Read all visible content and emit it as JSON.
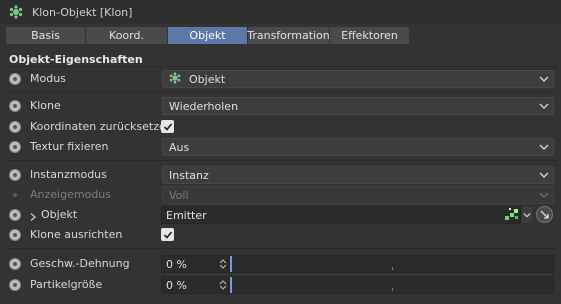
{
  "window": {
    "title": "Klon-Objekt [Klon]"
  },
  "tabs": [
    {
      "label": "Basis",
      "active": false
    },
    {
      "label": "Koord.",
      "active": false
    },
    {
      "label": "Objekt",
      "active": true
    },
    {
      "label": "Transformation",
      "active": false
    },
    {
      "label": "Effektoren",
      "active": false
    }
  ],
  "section": {
    "title": "Objekt-Eigenschaften"
  },
  "params": {
    "modus": {
      "label": "Modus",
      "value": "Objekt"
    },
    "klone": {
      "label": "Klone",
      "value": "Wiederholen"
    },
    "reset_coords": {
      "label": "Koordinaten zurücksetzen",
      "checked": true
    },
    "textur": {
      "label": "Textur fixieren",
      "value": "Aus"
    },
    "instanzmodus": {
      "label": "Instanzmodus",
      "value": "Instanz"
    },
    "anzeigemodus": {
      "label": "Anzeigemodus",
      "value": "Voll",
      "disabled": true
    },
    "objekt": {
      "label": "Objekt",
      "value": "Emitter"
    },
    "klone_ausrichten": {
      "label": "Klone ausrichten",
      "checked": true
    },
    "geschw_dehnung": {
      "label": "Geschw.-Dehnung",
      "value": "0 %"
    },
    "partikelgroesse": {
      "label": "Partikelgröße",
      "value": "0 %"
    }
  },
  "colors": {
    "accent": "#5b79a8",
    "background": "#333333",
    "slider_handle": "#6fa0e0"
  },
  "icons": [
    "cloner-icon",
    "chevron-down-icon",
    "checkmark-icon",
    "emitter-icon",
    "target-icon",
    "spinner-icon",
    "expand-arrow-icon"
  ]
}
